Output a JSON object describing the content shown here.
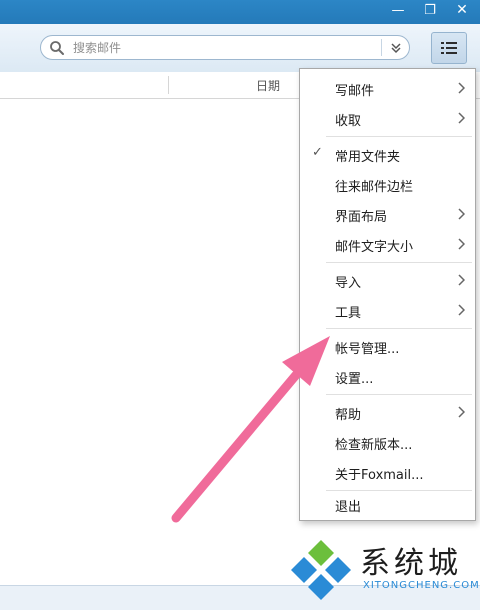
{
  "window": {
    "minimize_glyph": "—",
    "restore_glyph": "❐",
    "close_glyph": "✕"
  },
  "search": {
    "placeholder": "搜索邮件"
  },
  "mail_list": {
    "column_date": "日期"
  },
  "menu": {
    "items": [
      {
        "label": "写邮件",
        "submenu": true,
        "checked": false
      },
      {
        "label": "收取",
        "submenu": true,
        "checked": false
      },
      {
        "label": "常用文件夹",
        "submenu": false,
        "checked": true
      },
      {
        "label": "往来邮件边栏",
        "submenu": false,
        "checked": false
      },
      {
        "label": "界面布局",
        "submenu": true,
        "checked": false
      },
      {
        "label": "邮件文字大小",
        "submenu": true,
        "checked": false
      },
      {
        "label": "导入",
        "submenu": true,
        "checked": false
      },
      {
        "label": "工具",
        "submenu": true,
        "checked": false
      },
      {
        "label": "帐号管理...",
        "submenu": false,
        "checked": false
      },
      {
        "label": "设置...",
        "submenu": false,
        "checked": false
      },
      {
        "label": "帮助",
        "submenu": true,
        "checked": false
      },
      {
        "label": "检查新版本...",
        "submenu": false,
        "checked": false
      },
      {
        "label": "关于Foxmail...",
        "submenu": false,
        "checked": false
      },
      {
        "label": "退出",
        "submenu": false,
        "checked": false
      }
    ],
    "check_glyph": "✓"
  },
  "watermark": {
    "title": "系统城",
    "subtitle": "XITONGCHENG.COM"
  },
  "colors": {
    "titlebar": "#247ab9",
    "annotation_arrow": "#f06b9a",
    "watermark_blue": "#2a8bd6",
    "watermark_green": "#6cbf3c"
  }
}
